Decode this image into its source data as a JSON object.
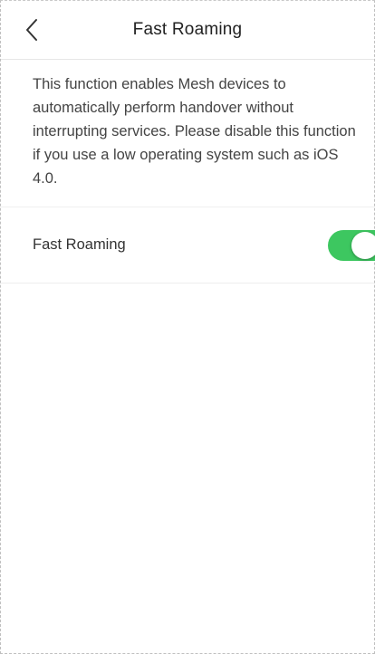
{
  "nav": {
    "back_icon": "chevron-left-icon",
    "title": "Fast Roaming"
  },
  "description": {
    "text": "This function enables Mesh devices to automatically perform handover without interrupting services. Please disable this function if you use a low operating system such as iOS 4.0."
  },
  "setting": {
    "label": "Fast Roaming",
    "enabled": true,
    "toggle_color": "#3dc760"
  }
}
